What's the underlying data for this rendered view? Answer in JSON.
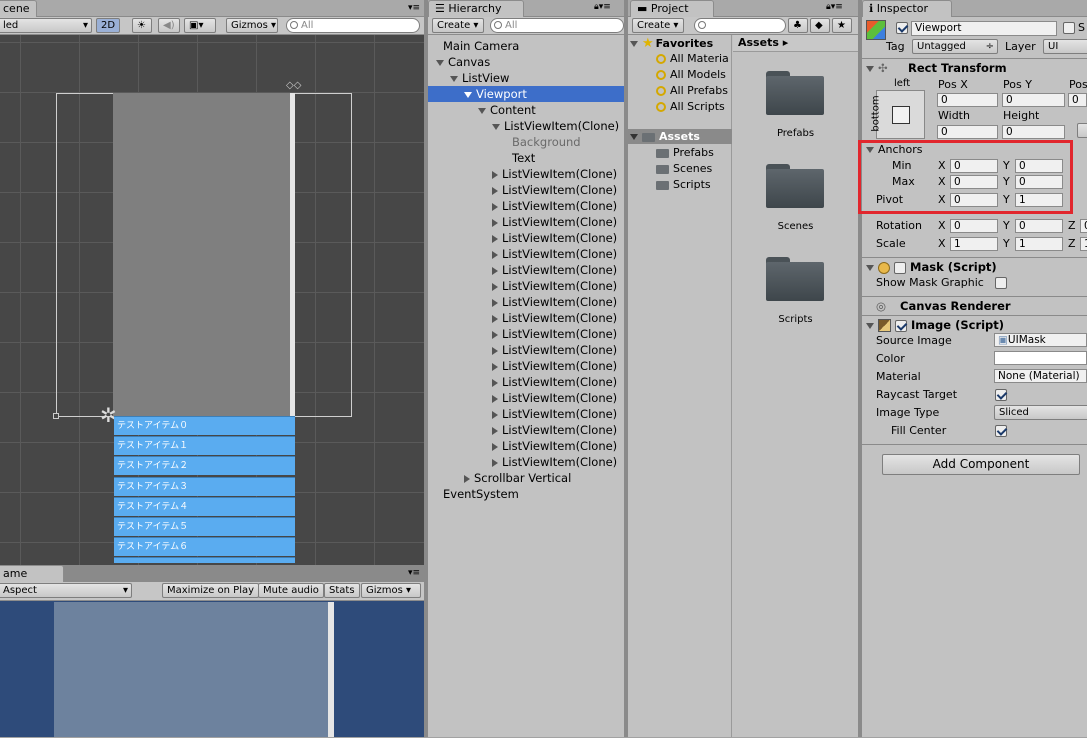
{
  "scene": {
    "tab": "cene",
    "shading": "led",
    "mode_2d": "2D",
    "gizmos": "Gizmos",
    "search_placeholder": "All",
    "items": [
      "テストアイテム０",
      "テストアイテム１",
      "テストアイテム２",
      "テストアイテム３",
      "テストアイテム４",
      "テストアイテム５",
      "テストアイテム６"
    ]
  },
  "game": {
    "tab": "ame",
    "aspect": "Aspect",
    "maximize": "Maximize on Play",
    "mute": "Mute audio",
    "stats": "Stats",
    "gizmos": "Gizmos"
  },
  "hierarchy": {
    "tab": "Hierarchy",
    "create": "Create",
    "search_placeholder": "All",
    "rows": [
      {
        "label": "Main Camera"
      },
      {
        "label": "Canvas"
      },
      {
        "label": "ListView"
      },
      {
        "label": "Viewport"
      },
      {
        "label": "Content"
      },
      {
        "label": "ListViewItem(Clone)"
      },
      {
        "label": "Background"
      },
      {
        "label": "Text"
      },
      {
        "label": "ListViewItem(Clone)"
      },
      {
        "label": "ListViewItem(Clone)"
      },
      {
        "label": "ListViewItem(Clone)"
      },
      {
        "label": "ListViewItem(Clone)"
      },
      {
        "label": "ListViewItem(Clone)"
      },
      {
        "label": "ListViewItem(Clone)"
      },
      {
        "label": "ListViewItem(Clone)"
      },
      {
        "label": "ListViewItem(Clone)"
      },
      {
        "label": "ListViewItem(Clone)"
      },
      {
        "label": "ListViewItem(Clone)"
      },
      {
        "label": "ListViewItem(Clone)"
      },
      {
        "label": "ListViewItem(Clone)"
      },
      {
        "label": "ListViewItem(Clone)"
      },
      {
        "label": "ListViewItem(Clone)"
      },
      {
        "label": "ListViewItem(Clone)"
      },
      {
        "label": "ListViewItem(Clone)"
      },
      {
        "label": "ListViewItem(Clone)"
      },
      {
        "label": "ListViewItem(Clone)"
      },
      {
        "label": "ListViewItem(Clone)"
      },
      {
        "label": "Scrollbar Vertical"
      },
      {
        "label": "EventSystem"
      }
    ]
  },
  "project": {
    "tab": "Project",
    "create": "Create",
    "favorites": "Favorites",
    "fav_items": [
      "All Materia",
      "All Models",
      "All Prefabs",
      "All Scripts"
    ],
    "assets_header": "Assets",
    "asset_tree": [
      "Prefabs",
      "Scenes",
      "Scripts"
    ],
    "breadcrumb": "Assets",
    "folders": [
      "Prefabs",
      "Scenes",
      "Scripts"
    ]
  },
  "inspector": {
    "tab": "Inspector",
    "object_name": "Viewport",
    "static_label": "S",
    "tag_label": "Tag",
    "tag_value": "Untagged",
    "layer_label": "Layer",
    "layer_value": "UI",
    "rect_transform": {
      "title": "Rect Transform",
      "anchor_h": "left",
      "anchor_v": "bottom",
      "pos_x_label": "Pos X",
      "pos_y_label": "Pos Y",
      "pos_z_label": "Pos",
      "pos_x": "0",
      "pos_y": "0",
      "pos_z": "0",
      "width_label": "Width",
      "height_label": "Height",
      "width": "0",
      "height": "0",
      "anchors_label": "Anchors",
      "min_label": "Min",
      "max_label": "Max",
      "min_x": "0",
      "min_y": "0",
      "max_x": "0",
      "max_y": "0",
      "pivot_label": "Pivot",
      "pivot_x": "0",
      "pivot_y": "1",
      "rotation_label": "Rotation",
      "rot_x": "0",
      "rot_y": "0",
      "rot_z": "0",
      "scale_label": "Scale",
      "scale_x": "1",
      "scale_y": "1",
      "scale_z": "1",
      "x": "X",
      "y": "Y",
      "z": "Z"
    },
    "mask": {
      "title": "Mask (Script)",
      "show_mask_graphic": "Show Mask Graphic"
    },
    "canvas_renderer": {
      "title": "Canvas Renderer"
    },
    "image": {
      "title": "Image (Script)",
      "source_image_label": "Source Image",
      "source_image": "UIMask",
      "color_label": "Color",
      "material_label": "Material",
      "material": "None (Material)",
      "raycast_label": "Raycast Target",
      "image_type_label": "Image Type",
      "image_type": "Sliced",
      "fill_center_label": "Fill Center"
    },
    "add_component": "Add Component"
  },
  "colors": {
    "highlight": "#e1262d",
    "selection": "#3d6ec9",
    "list_item": "#5aacf0"
  }
}
